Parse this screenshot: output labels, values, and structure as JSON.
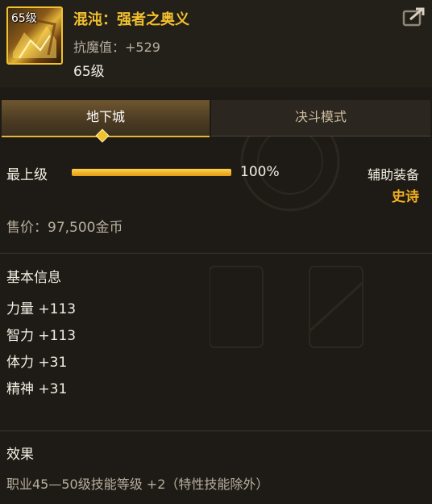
{
  "item": {
    "level_badge": "65级",
    "name": "混沌：强者之奥义",
    "resistance": "抗魔值：+529",
    "level": "65级"
  },
  "tabs": [
    {
      "label": "地下城",
      "active": true
    },
    {
      "label": "决斗模式",
      "active": false
    }
  ],
  "grade": {
    "label": "最上级",
    "percent_text": "100%",
    "fill_fraction": 1.0
  },
  "slot": {
    "type": "辅助装备",
    "rarity": "史诗"
  },
  "price": "售价：97,500金币",
  "basic_info": {
    "title": "基本信息",
    "stats": [
      "力量 +113",
      "智力 +113",
      "体力 +31",
      "精神 +31"
    ]
  },
  "effect": {
    "title": "效果",
    "text": "职业45—50级技能等级 +2（特性技能除外）"
  },
  "colors": {
    "accent_gold": "#f2c12e",
    "rarity_epic": "#f2b020",
    "background": "#1e1b16"
  },
  "icons": [
    "share-icon",
    "tab-marker-icon"
  ]
}
